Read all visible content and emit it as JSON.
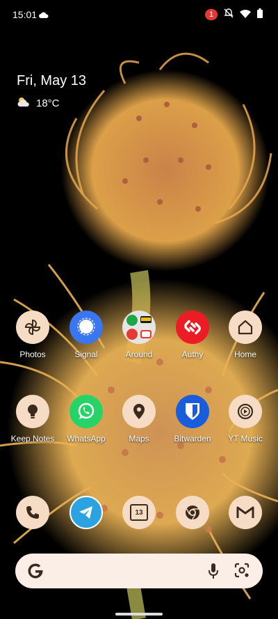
{
  "status_bar": {
    "time": "15:01",
    "notification_count": "1",
    "icons": [
      "cloud-icon",
      "mute-icon",
      "wifi-icon",
      "battery-icon"
    ]
  },
  "widget": {
    "date": "Fri, May 13",
    "temperature": "18°C",
    "weather_icon": "partly-cloudy-icon"
  },
  "apps_row1": [
    {
      "label": "Photos",
      "icon": "pinwheel-icon"
    },
    {
      "label": "Signal",
      "icon": "chat-bubble-icon"
    },
    {
      "label": "Around",
      "icon": "folder-icon"
    },
    {
      "label": "Authy",
      "icon": "authy-icon"
    },
    {
      "label": "Home",
      "icon": "home-icon"
    }
  ],
  "apps_row2": [
    {
      "label": "Keep Notes",
      "icon": "bulb-icon"
    },
    {
      "label": "WhatsApp",
      "icon": "whatsapp-icon"
    },
    {
      "label": "Maps",
      "icon": "map-pin-icon"
    },
    {
      "label": "Bitwarden",
      "icon": "shield-icon"
    },
    {
      "label": "YT Music",
      "icon": "play-circle-icon"
    }
  ],
  "dock": [
    {
      "name": "phone",
      "icon": "phone-icon"
    },
    {
      "name": "telegram",
      "icon": "paper-plane-icon"
    },
    {
      "name": "calendar",
      "icon": "calendar-icon",
      "day": "13"
    },
    {
      "name": "chrome",
      "icon": "chrome-icon"
    },
    {
      "name": "gmail",
      "icon": "gmail-icon"
    }
  ],
  "search_bar": {
    "logo": "G",
    "icons": [
      "mic-icon",
      "lens-icon"
    ]
  },
  "colors": {
    "icon_bg": "#f6dcc4",
    "icon_fg": "#3a2a1e",
    "signal": "#3a76f0",
    "whatsapp": "#25d366",
    "authy": "#ec1c24",
    "bitwarden": "#175ddc",
    "telegram": "#2aa3e0"
  }
}
